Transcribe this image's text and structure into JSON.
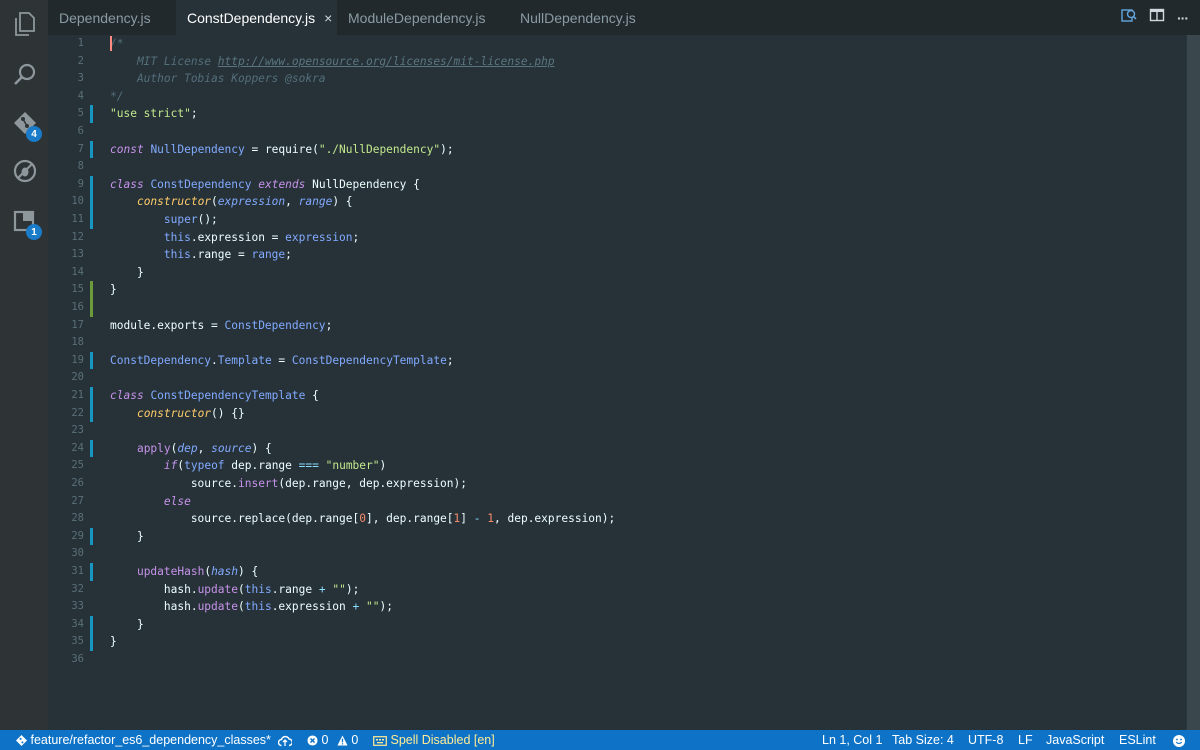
{
  "tabs": [
    {
      "label": "Dependency.js",
      "active": false
    },
    {
      "label": "ConstDependency.js",
      "active": true
    },
    {
      "label": "ModuleDependency.js",
      "active": false
    },
    {
      "label": "NullDependency.js",
      "active": false
    }
  ],
  "tab_close_glyph": "×",
  "activity_bar": {
    "icons": [
      "files-icon",
      "search-icon",
      "git-icon",
      "debug-icon",
      "extensions-icon"
    ],
    "git_badge": "4",
    "extensions_badge": "1"
  },
  "editor_actions": {
    "more_glyph": "···"
  },
  "colors": {
    "comment": "#546e7a",
    "keyword": "#c792ea",
    "string": "#c3e88d",
    "plain": "#eeffff",
    "class_name": "#82aaff",
    "function": "#ffcb6b",
    "param": "#82aaff",
    "number": "#f78c6c",
    "operator": "#89ddff",
    "method": "#c792ea",
    "this": "#82aaff",
    "link": "#5b7580",
    "status_bar": "#0e73c7",
    "spell_warning": "#ffeb95",
    "gutter_modified": "#1796c1",
    "gutter_added": "#6d9a38"
  },
  "lines": [
    {
      "n": "1",
      "g": "",
      "cursor": true,
      "t": [
        [
          "/*",
          "comment"
        ]
      ]
    },
    {
      "n": "2",
      "g": "",
      "t": [
        [
          "    MIT License ",
          "comment"
        ],
        [
          "http://www.opensource.org/licenses/mit-license.php",
          "link"
        ]
      ]
    },
    {
      "n": "3",
      "g": "",
      "t": [
        [
          "    Author Tobias Koppers @sokra",
          "comment"
        ]
      ]
    },
    {
      "n": "4",
      "g": "",
      "t": [
        [
          "*/",
          "comment"
        ]
      ]
    },
    {
      "n": "5",
      "g": "mod",
      "t": [
        [
          "\"use strict\"",
          "string"
        ],
        [
          ";",
          "plain"
        ]
      ]
    },
    {
      "n": "6",
      "g": "",
      "t": []
    },
    {
      "n": "7",
      "g": "mod",
      "t": [
        [
          "const",
          "keyword"
        ],
        [
          " ",
          "plain"
        ],
        [
          "NullDependency",
          "class_name"
        ],
        [
          " = require(",
          "plain"
        ],
        [
          "\"./NullDependency\"",
          "string"
        ],
        [
          ");",
          "plain"
        ]
      ]
    },
    {
      "n": "8",
      "g": "",
      "t": []
    },
    {
      "n": "9",
      "g": "mod",
      "t": [
        [
          "class",
          "keyword"
        ],
        [
          " ",
          "plain"
        ],
        [
          "ConstDependency",
          "class_name"
        ],
        [
          " ",
          "plain"
        ],
        [
          "extends",
          "keyword"
        ],
        [
          " NullDependency {",
          "plain"
        ]
      ]
    },
    {
      "n": "10",
      "g": "mod",
      "t": [
        [
          "    ",
          "plain"
        ],
        [
          "constructor",
          "function"
        ],
        [
          "(",
          "plain"
        ],
        [
          "expression",
          "param"
        ],
        [
          ", ",
          "plain"
        ],
        [
          "range",
          "param"
        ],
        [
          ") {",
          "plain"
        ]
      ]
    },
    {
      "n": "11",
      "g": "mod",
      "t": [
        [
          "        ",
          "plain"
        ],
        [
          "super",
          "class_name"
        ],
        [
          "();",
          "plain"
        ]
      ]
    },
    {
      "n": "12",
      "g": "",
      "t": [
        [
          "        ",
          "plain"
        ],
        [
          "this",
          "this"
        ],
        [
          ".expression = ",
          "plain"
        ],
        [
          "expression",
          "class_name"
        ],
        [
          ";",
          "plain"
        ]
      ]
    },
    {
      "n": "13",
      "g": "",
      "t": [
        [
          "        ",
          "plain"
        ],
        [
          "this",
          "this"
        ],
        [
          ".range = ",
          "plain"
        ],
        [
          "range",
          "class_name"
        ],
        [
          ";",
          "plain"
        ]
      ]
    },
    {
      "n": "14",
      "g": "",
      "t": [
        [
          "    }",
          "plain"
        ]
      ]
    },
    {
      "n": "15",
      "g": "add",
      "t": [
        [
          "}",
          "plain"
        ]
      ]
    },
    {
      "n": "16",
      "g": "add",
      "t": []
    },
    {
      "n": "17",
      "g": "",
      "t": [
        [
          "module.exports = ",
          "plain"
        ],
        [
          "ConstDependency",
          "class_name"
        ],
        [
          ";",
          "plain"
        ]
      ]
    },
    {
      "n": "18",
      "g": "",
      "t": []
    },
    {
      "n": "19",
      "g": "mod",
      "t": [
        [
          "ConstDependency",
          "class_name"
        ],
        [
          ".",
          "plain"
        ],
        [
          "Template",
          "class_name"
        ],
        [
          " = ",
          "plain"
        ],
        [
          "ConstDependencyTemplate",
          "class_name"
        ],
        [
          ";",
          "plain"
        ]
      ]
    },
    {
      "n": "20",
      "g": "",
      "t": []
    },
    {
      "n": "21",
      "g": "mod",
      "t": [
        [
          "class",
          "keyword"
        ],
        [
          " ",
          "plain"
        ],
        [
          "ConstDependencyTemplate",
          "class_name"
        ],
        [
          " {",
          "plain"
        ]
      ]
    },
    {
      "n": "22",
      "g": "mod",
      "t": [
        [
          "    ",
          "plain"
        ],
        [
          "constructor",
          "function"
        ],
        [
          "() {}",
          "plain"
        ]
      ]
    },
    {
      "n": "23",
      "g": "",
      "t": []
    },
    {
      "n": "24",
      "g": "mod",
      "t": [
        [
          "    ",
          "plain"
        ],
        [
          "apply",
          "method"
        ],
        [
          "(",
          "plain"
        ],
        [
          "dep",
          "param"
        ],
        [
          ", ",
          "plain"
        ],
        [
          "source",
          "param"
        ],
        [
          ") {",
          "plain"
        ]
      ]
    },
    {
      "n": "25",
      "g": "",
      "t": [
        [
          "        ",
          "plain"
        ],
        [
          "if",
          "keyword"
        ],
        [
          "(",
          "plain"
        ],
        [
          "typeof",
          "class_name"
        ],
        [
          " dep.range ",
          "plain"
        ],
        [
          "===",
          "operator"
        ],
        [
          " ",
          "plain"
        ],
        [
          "\"number\"",
          "string"
        ],
        [
          ")",
          "plain"
        ]
      ]
    },
    {
      "n": "26",
      "g": "",
      "t": [
        [
          "            source.",
          "plain"
        ],
        [
          "insert",
          "method"
        ],
        [
          "(dep.range, dep.expression);",
          "plain"
        ]
      ]
    },
    {
      "n": "27",
      "g": "",
      "t": [
        [
          "        ",
          "plain"
        ],
        [
          "else",
          "keyword"
        ]
      ]
    },
    {
      "n": "28",
      "g": "",
      "t": [
        [
          "            source.replace(dep.range[",
          "plain"
        ],
        [
          "0",
          "number"
        ],
        [
          "], dep.range[",
          "plain"
        ],
        [
          "1",
          "number"
        ],
        [
          "] ",
          "plain"
        ],
        [
          "-",
          "operator"
        ],
        [
          " ",
          "plain"
        ],
        [
          "1",
          "number"
        ],
        [
          ", dep.expression);",
          "plain"
        ]
      ]
    },
    {
      "n": "29",
      "g": "mod",
      "t": [
        [
          "    }",
          "plain"
        ]
      ]
    },
    {
      "n": "30",
      "g": "",
      "t": []
    },
    {
      "n": "31",
      "g": "mod",
      "t": [
        [
          "    ",
          "plain"
        ],
        [
          "updateHash",
          "method"
        ],
        [
          "(",
          "plain"
        ],
        [
          "hash",
          "param"
        ],
        [
          ") {",
          "plain"
        ]
      ]
    },
    {
      "n": "32",
      "g": "",
      "t": [
        [
          "        hash.",
          "plain"
        ],
        [
          "update",
          "method"
        ],
        [
          "(",
          "plain"
        ],
        [
          "this",
          "this"
        ],
        [
          ".range ",
          "plain"
        ],
        [
          "+",
          "operator"
        ],
        [
          " ",
          "plain"
        ],
        [
          "\"\"",
          "string"
        ],
        [
          ");",
          "plain"
        ]
      ]
    },
    {
      "n": "33",
      "g": "",
      "t": [
        [
          "        hash.",
          "plain"
        ],
        [
          "update",
          "method"
        ],
        [
          "(",
          "plain"
        ],
        [
          "this",
          "this"
        ],
        [
          ".expression ",
          "plain"
        ],
        [
          "+",
          "operator"
        ],
        [
          " ",
          "plain"
        ],
        [
          "\"\"",
          "string"
        ],
        [
          ");",
          "plain"
        ]
      ]
    },
    {
      "n": "34",
      "g": "mod",
      "t": [
        [
          "    }",
          "plain"
        ]
      ]
    },
    {
      "n": "35",
      "g": "mod",
      "t": [
        [
          "}",
          "plain"
        ]
      ]
    },
    {
      "n": "36",
      "g": "",
      "t": []
    }
  ],
  "status": {
    "branch": "feature/refactor_es6_dependency_classes*",
    "errors": "0",
    "warnings": "0",
    "spell": "Spell Disabled [en]",
    "position": "Ln 1, Col 1",
    "tab_size": "Tab Size: 4",
    "encoding": "UTF-8",
    "eol": "LF",
    "language": "JavaScript",
    "linter": "ESLint"
  }
}
